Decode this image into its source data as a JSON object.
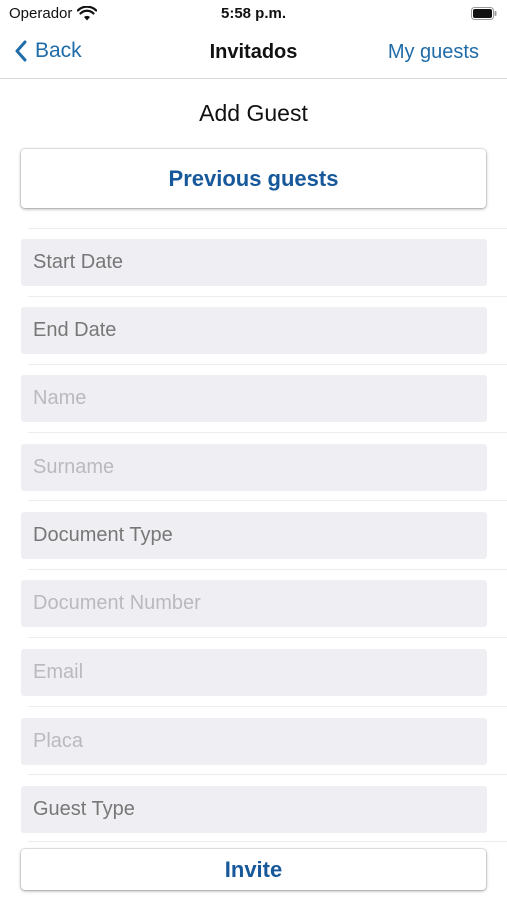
{
  "status_bar": {
    "carrier": "Operador",
    "time": "5:58 p.m."
  },
  "nav": {
    "back_label": "Back",
    "title": "Invitados",
    "right_label": "My guests"
  },
  "page_title": "Add Guest",
  "previous_guests_label": "Previous guests",
  "fields": {
    "start_date": "Start Date",
    "end_date": "End Date",
    "name": "Name",
    "surname": "Surname",
    "document_type": "Document Type",
    "document_number": "Document Number",
    "email": "Email",
    "placa": "Placa",
    "guest_type": "Guest Type"
  },
  "invite_label": "Invite",
  "colors": {
    "accent": "#1f6ca8",
    "button_text": "#16589a",
    "field_bg": "#efeff3"
  }
}
